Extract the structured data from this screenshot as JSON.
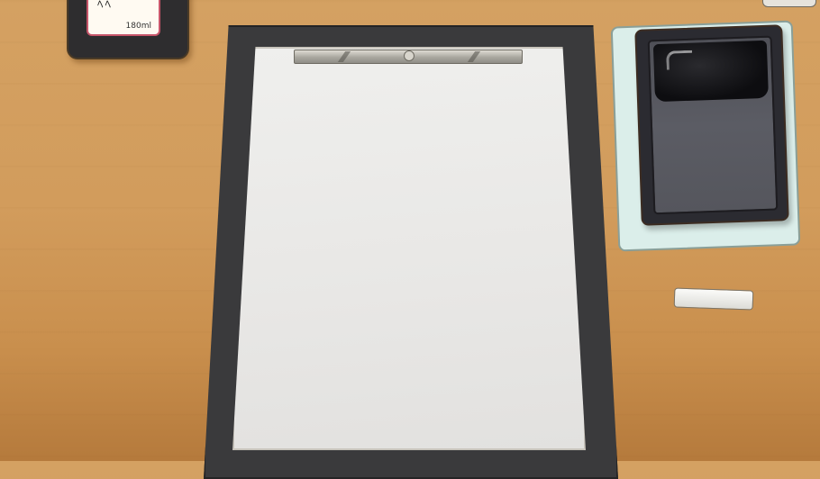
{
  "scene": {
    "description_free": true,
    "ink_bottle": {
      "label_text": "180ml"
    },
    "colors": {
      "desk": "#d4a162",
      "board": "#3a3a3c",
      "paper": "#ecebea",
      "mat": "#dbeeea",
      "inkstone": "#2b2b31"
    },
    "icons": [
      "ink-bottle-icon",
      "paperweight-icon",
      "inkstone-icon",
      "eraser-icon"
    ]
  }
}
